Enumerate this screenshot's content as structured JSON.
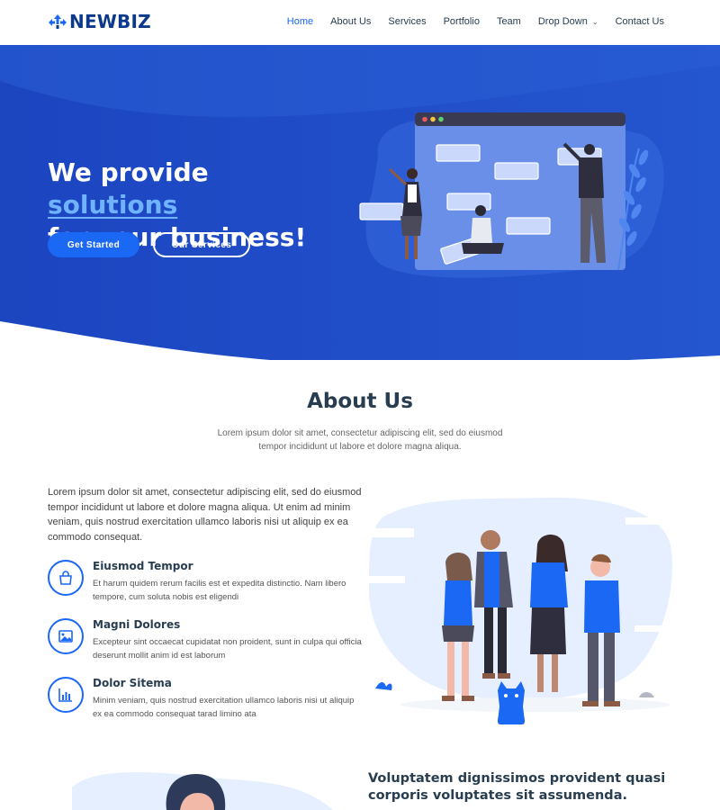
{
  "header": {
    "logo_text": "NEWBIZ",
    "nav": [
      {
        "label": "Home",
        "active": true
      },
      {
        "label": "About Us"
      },
      {
        "label": "Services"
      },
      {
        "label": "Portfolio"
      },
      {
        "label": "Team"
      },
      {
        "label": "Drop Down",
        "has_dropdown": true
      },
      {
        "label": "Contact Us"
      }
    ]
  },
  "hero": {
    "title_line1": "We provide",
    "title_line2": "solutions",
    "title_line3": "for your business!",
    "primary_button": "Get Started",
    "secondary_button": "Our Services"
  },
  "about": {
    "title": "About Us",
    "subtitle": "Lorem ipsum dolor sit amet, consectetur adipiscing elit, sed do eiusmod tempor incididunt ut labore et dolore magna aliqua.",
    "intro": "Lorem ipsum dolor sit amet, consectetur adipiscing elit, sed do eiusmod tempor incididunt ut labore et dolore magna aliqua. Ut enim ad minim veniam, quis nostrud exercitation ullamco laboris nisi ut aliquip ex ea commodo consequat.",
    "features": [
      {
        "title": "Eiusmod Tempor",
        "text": "Et harum quidem rerum facilis est et expedita distinctio. Nam libero tempore, cum soluta nobis est eligendi",
        "icon": "shopping-bag-icon"
      },
      {
        "title": "Magni Dolores",
        "text": "Excepteur sint occaecat cupidatat non proident, sunt in culpa qui officia deserunt mollit anim id est laborum",
        "icon": "image-icon"
      },
      {
        "title": "Dolor Sitema",
        "text": "Minim veniam, quis nostrud exercitation ullamco laboris nisi ut aliquip ex ea commodo consequat tarad limino ata",
        "icon": "bar-chart-icon"
      }
    ]
  },
  "next_section": {
    "title": "Voluptatem dignissimos provident quasi corporis voluptates sit assumenda."
  },
  "colors": {
    "accent": "#1b68f5",
    "hero_blue": "#1f4fc8",
    "heading": "#283d50"
  }
}
